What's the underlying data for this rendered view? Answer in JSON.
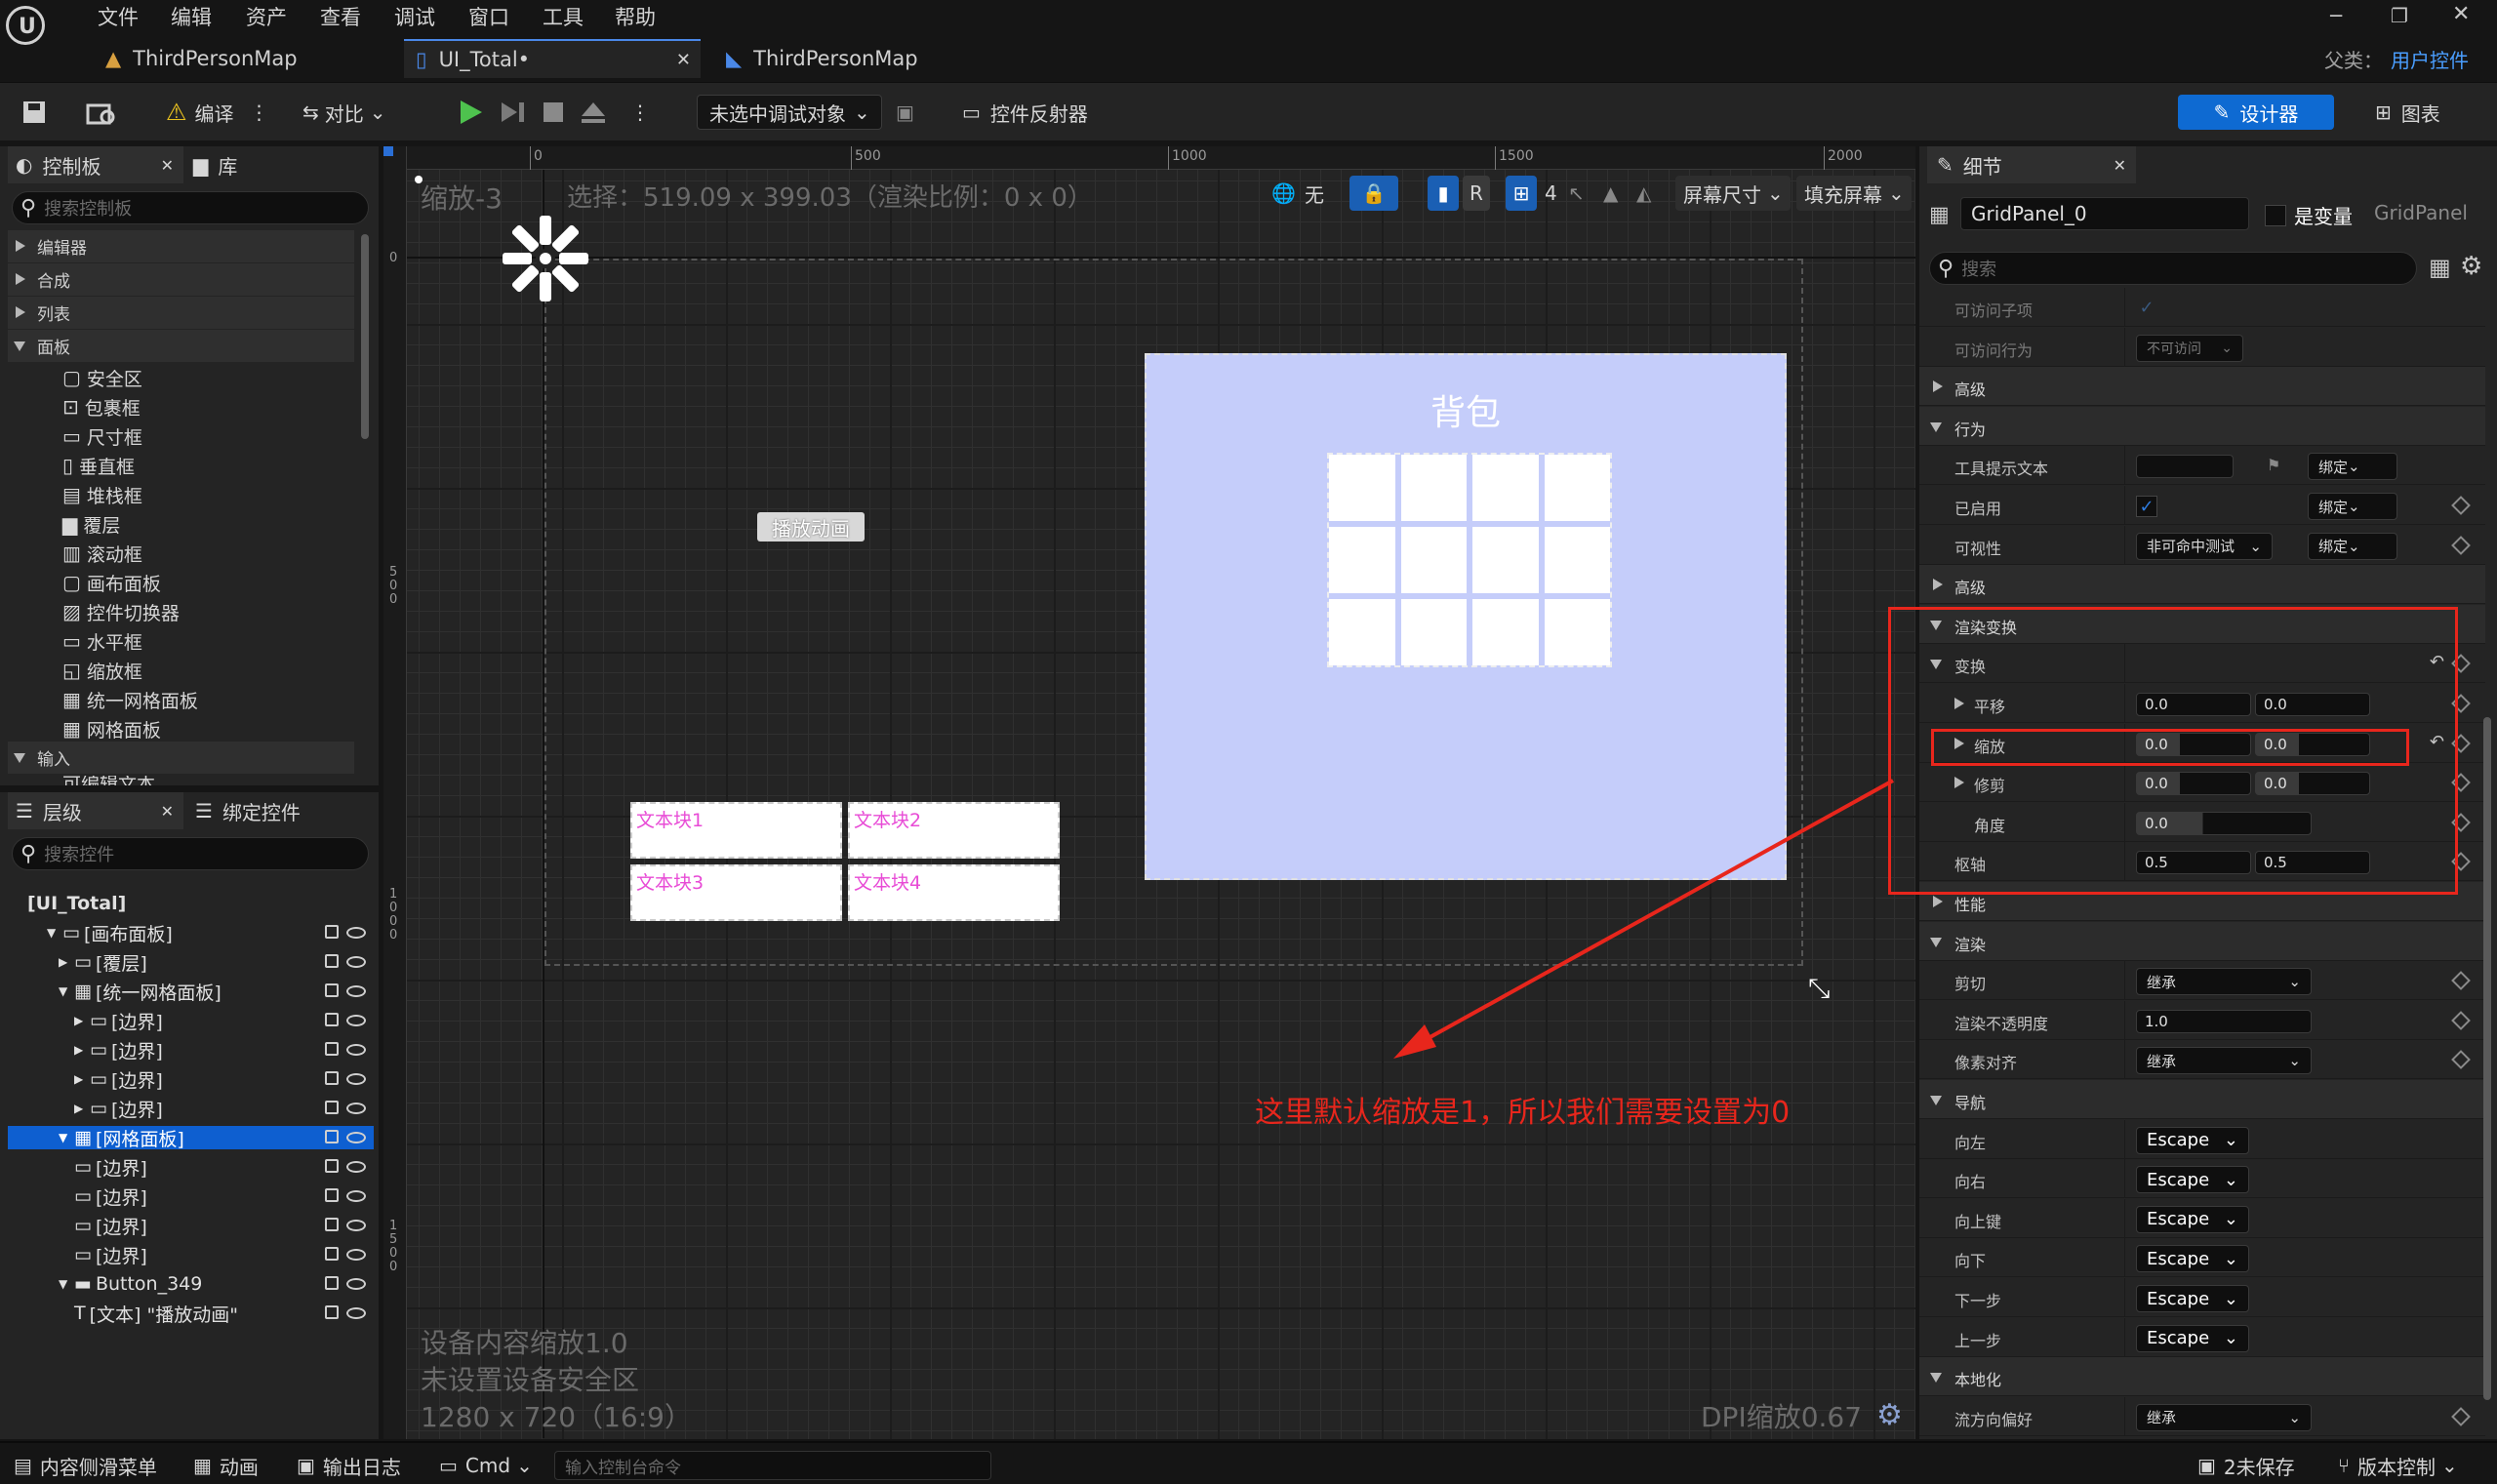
{
  "menu": [
    "文件",
    "编辑",
    "资产",
    "查看",
    "调试",
    "窗口",
    "工具",
    "帮助"
  ],
  "tabs": [
    {
      "label": "ThirdPersonMap"
    },
    {
      "label": "UI_Total•"
    },
    {
      "label": "ThirdPersonMap"
    }
  ],
  "parent": {
    "label": "父类：",
    "value": "用户控件"
  },
  "toolbar": {
    "compile": "编译",
    "diff": "对比",
    "debug_target": "未选中调试对象",
    "reflector": "控件反射器",
    "designer": "设计器",
    "graph": "图表"
  },
  "palette": {
    "tab": "控制板",
    "library_tab": "库",
    "search_placeholder": "搜索控制板",
    "categories": [
      "编辑器",
      "合成",
      "列表",
      "面板",
      "输入"
    ],
    "panel_items": [
      "安全区",
      "包裹框",
      "尺寸框",
      "垂直框",
      "堆栈框",
      "覆层",
      "滚动框",
      "画布面板",
      "控件切换器",
      "水平框",
      "缩放框",
      "统一网格面板",
      "网格面板"
    ],
    "cut_item": "可编辑文本"
  },
  "hierarchy": {
    "tab": "层级",
    "bind_tab": "绑定控件",
    "search_placeholder": "搜索控件",
    "nodes": [
      "[UI_Total]",
      "[画布面板]",
      "[覆层]",
      "[统一网格面板]",
      "[边界]",
      "[边界]",
      "[边界]",
      "[边界]",
      "[网格面板]",
      "[边界]",
      "[边界]",
      "[边界]",
      "[边界]",
      "Button_349",
      "[文本] \"播放动画\""
    ]
  },
  "canvas": {
    "zoom": "缩放-3",
    "selection": "选择：519.09 x 399.03（渲染比例：0 x 0）",
    "ruler_top": [
      "0",
      "500",
      "1000",
      "1500",
      "2000"
    ],
    "ruler_left": [
      "0",
      "500",
      "1000",
      "1500"
    ],
    "tools": {
      "none": "无",
      "r": "R",
      "grid_num": "4",
      "screen_size": "屏幕尺寸",
      "fill_screen": "填充屏幕"
    },
    "bag_title": "背包",
    "play_button": "播放动画",
    "text_blocks": [
      "文本块1",
      "文本块2",
      "文本块3",
      "文本块4"
    ],
    "annotation": "这里默认缩放是1，所以我们需要设置为0",
    "footer": [
      "设备内容缩放1.0",
      "未设置设备安全区",
      "1280 x 720（16:9）"
    ],
    "dpi": "DPI缩放0.67",
    "colors": {
      "bag_bg": "#c5cdfa",
      "annotation": "#e8261c",
      "text_pink": "#e84bd6"
    }
  },
  "details": {
    "tab": "细节",
    "name": "GridPanel_0",
    "is_variable": "是变量",
    "class": "GridPanel",
    "search_placeholder": "搜索",
    "rows": [
      {
        "label": "可访问子项",
        "type": "check"
      },
      {
        "label": "可访问行为",
        "type": "dd",
        "value": "不可访问"
      },
      {
        "label": "高级",
        "type": "sec"
      },
      {
        "label": "行为",
        "type": "sec"
      },
      {
        "label": "工具提示文本",
        "type": "text",
        "bind": "绑定"
      },
      {
        "label": "已启用",
        "type": "check",
        "bind": "绑定"
      },
      {
        "label": "可视性",
        "type": "dd",
        "value": "非可命中测试",
        "bind": "绑定"
      },
      {
        "label": "高级",
        "type": "sec"
      },
      {
        "label": "渲染变换",
        "type": "sec"
      },
      {
        "label": "变换",
        "type": "sub"
      },
      {
        "label": "平移",
        "type": "pair",
        "a": "0.0",
        "b": "0.0"
      },
      {
        "label": "缩放",
        "type": "pair",
        "a": "0.0",
        "b": "0.0"
      },
      {
        "label": "修剪",
        "type": "pair",
        "a": "0.0",
        "b": "0.0"
      },
      {
        "label": "角度",
        "type": "single",
        "a": "0.0"
      },
      {
        "label": "枢轴",
        "type": "pair",
        "a": "0.5",
        "b": "0.5"
      },
      {
        "label": "性能",
        "type": "sec"
      },
      {
        "label": "渲染",
        "type": "sec"
      },
      {
        "label": "剪切",
        "type": "dd",
        "value": "继承"
      },
      {
        "label": "渲染不透明度",
        "type": "single",
        "a": "1.0"
      },
      {
        "label": "像素对齐",
        "type": "dd",
        "value": "继承"
      },
      {
        "label": "导航",
        "type": "sec"
      },
      {
        "label": "向左",
        "type": "esc",
        "value": "Escape"
      },
      {
        "label": "向右",
        "type": "esc",
        "value": "Escape"
      },
      {
        "label": "向上键",
        "type": "esc",
        "value": "Escape"
      },
      {
        "label": "向下",
        "type": "esc",
        "value": "Escape"
      },
      {
        "label": "下一步",
        "type": "esc",
        "value": "Escape"
      },
      {
        "label": "上一步",
        "type": "esc",
        "value": "Escape"
      },
      {
        "label": "本地化",
        "type": "sec"
      },
      {
        "label": "流方向偏好",
        "type": "dd",
        "value": "继承"
      }
    ]
  },
  "status": {
    "drawer": "内容侧滑菜单",
    "anim": "动画",
    "log": "输出日志",
    "cmd": "Cmd",
    "console_placeholder": "输入控制台命令",
    "unsaved": "2未保存",
    "vc": "版本控制"
  }
}
